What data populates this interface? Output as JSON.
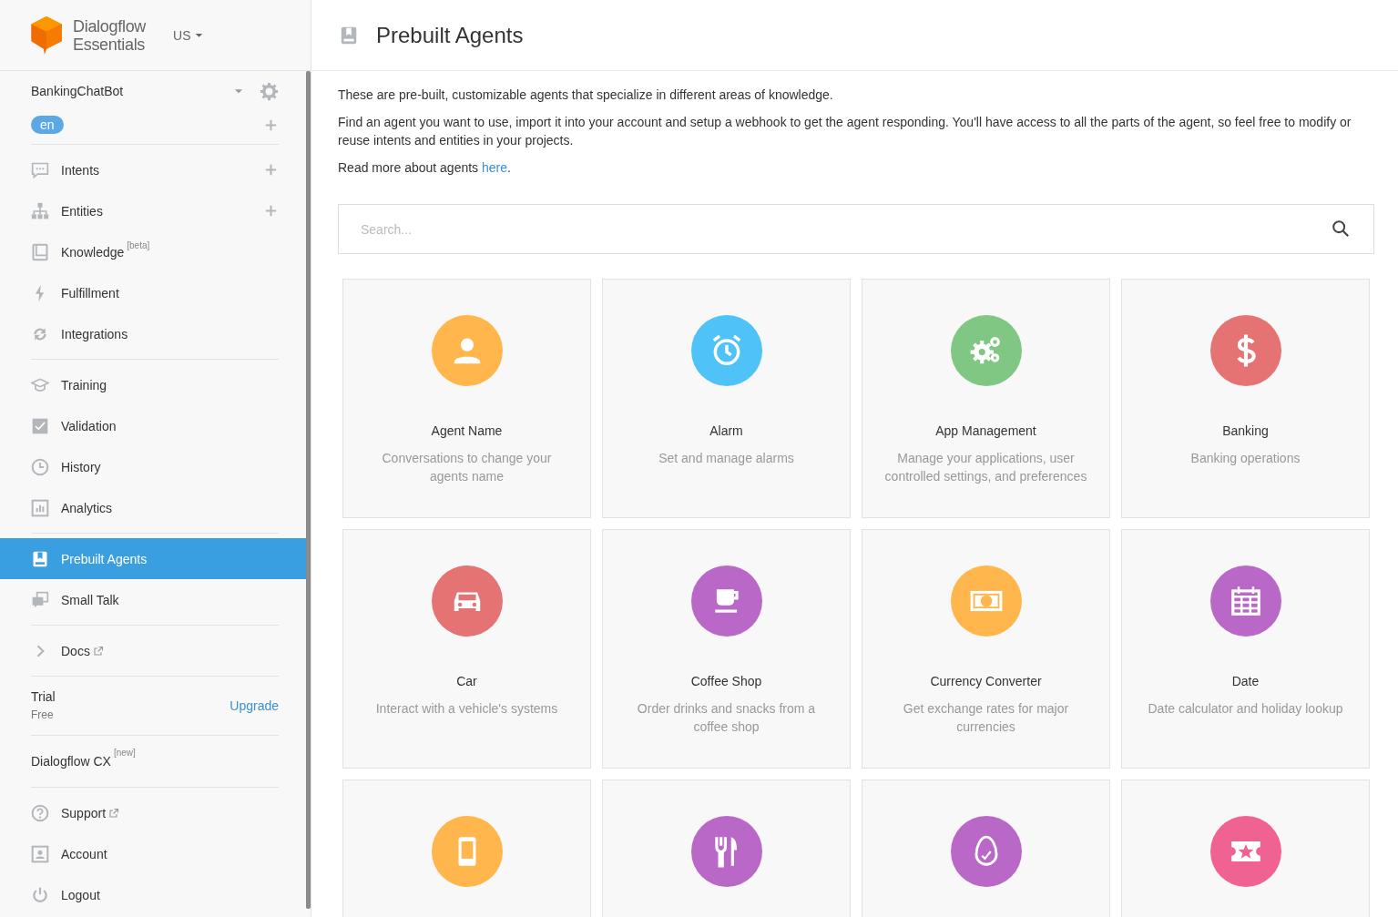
{
  "brand": {
    "line1": "Dialogflow",
    "line2": "Essentials",
    "region": "US"
  },
  "agent": {
    "name": "BankingChatBot",
    "language": "en"
  },
  "sidebar": {
    "sections": [
      {
        "items": [
          {
            "kind": "nav",
            "label": "Intents",
            "add": true,
            "external": false,
            "selected": false
          },
          {
            "kind": "nav",
            "label": "Entities",
            "add": true,
            "external": false,
            "selected": false
          },
          {
            "kind": "nav",
            "label": "Knowledge",
            "superscript": "[beta]",
            "add": false,
            "external": false,
            "selected": false
          },
          {
            "kind": "nav",
            "label": "Fulfillment",
            "add": false,
            "external": false,
            "selected": false
          },
          {
            "kind": "nav",
            "label": "Integrations",
            "add": false,
            "external": false,
            "selected": false
          }
        ]
      },
      {
        "items": [
          {
            "kind": "nav",
            "label": "Training",
            "add": false,
            "external": false,
            "selected": false
          },
          {
            "kind": "nav",
            "label": "Validation",
            "add": false,
            "external": false,
            "selected": false
          },
          {
            "kind": "nav",
            "label": "History",
            "add": false,
            "external": false,
            "selected": false
          },
          {
            "kind": "nav",
            "label": "Analytics",
            "add": false,
            "external": false,
            "selected": false
          }
        ]
      },
      {
        "items": [
          {
            "kind": "nav",
            "label": "Prebuilt Agents",
            "add": false,
            "external": false,
            "selected": true
          },
          {
            "kind": "nav",
            "label": "Small Talk",
            "add": false,
            "external": false,
            "selected": false
          }
        ]
      },
      {
        "items": [
          {
            "kind": "nav",
            "label": "Docs",
            "add": false,
            "external": true,
            "selected": false
          }
        ]
      },
      {
        "items": [
          {
            "kind": "plan",
            "title": "Trial",
            "subtitle": "Free",
            "action": "Upgrade"
          }
        ]
      },
      {
        "items": [
          {
            "kind": "promo",
            "label": "Dialogflow CX",
            "superscript": "[new]"
          }
        ]
      },
      {
        "items": [
          {
            "kind": "nav",
            "label": "Support",
            "add": false,
            "external": true,
            "selected": false
          },
          {
            "kind": "nav",
            "label": "Account",
            "add": false,
            "external": false,
            "selected": false
          },
          {
            "kind": "nav",
            "label": "Logout",
            "add": false,
            "external": false,
            "selected": false
          }
        ]
      }
    ]
  },
  "page": {
    "title": "Prebuilt Agents",
    "intro": [
      {
        "text": "These are pre-built, customizable agents that specialize in different areas of knowledge."
      },
      {
        "text": "Find an agent you want to use, import it into your account and setup a webhook to get the agent responding. You'll have access to all the parts of the agent, so feel free to modify or reuse intents and entities in your projects."
      },
      {
        "text": "Read more about agents ",
        "link": "here",
        "after": "."
      }
    ],
    "search": {
      "placeholder": "Search..."
    }
  },
  "cards": [
    {
      "name": "Agent Name",
      "description": "Conversations to change your agents name",
      "color": "#ffb74d"
    },
    {
      "name": "Alarm",
      "description": "Set and manage alarms",
      "color": "#4fc3f7"
    },
    {
      "name": "App Management",
      "description": "Manage your applications, user controlled settings, and preferences",
      "color": "#81c784"
    },
    {
      "name": "Banking",
      "description": "Banking operations",
      "color": "#e57373"
    },
    {
      "name": "Car",
      "description": "Interact with a vehicle's systems",
      "color": "#e57373"
    },
    {
      "name": "Coffee Shop",
      "description": "Order drinks and snacks from a coffee shop",
      "color": "#ba68c8"
    },
    {
      "name": "Currency Converter",
      "description": "Get exchange rates for major currencies",
      "color": "#ffb74d"
    },
    {
      "name": "Date",
      "description": "Date calculator and holiday lookup",
      "color": "#ba68c8"
    },
    {
      "color": "#ffb74d"
    },
    {
      "color": "#ba68c8"
    },
    {
      "color": "#ba68c8"
    },
    {
      "color": "#f06292"
    }
  ]
}
